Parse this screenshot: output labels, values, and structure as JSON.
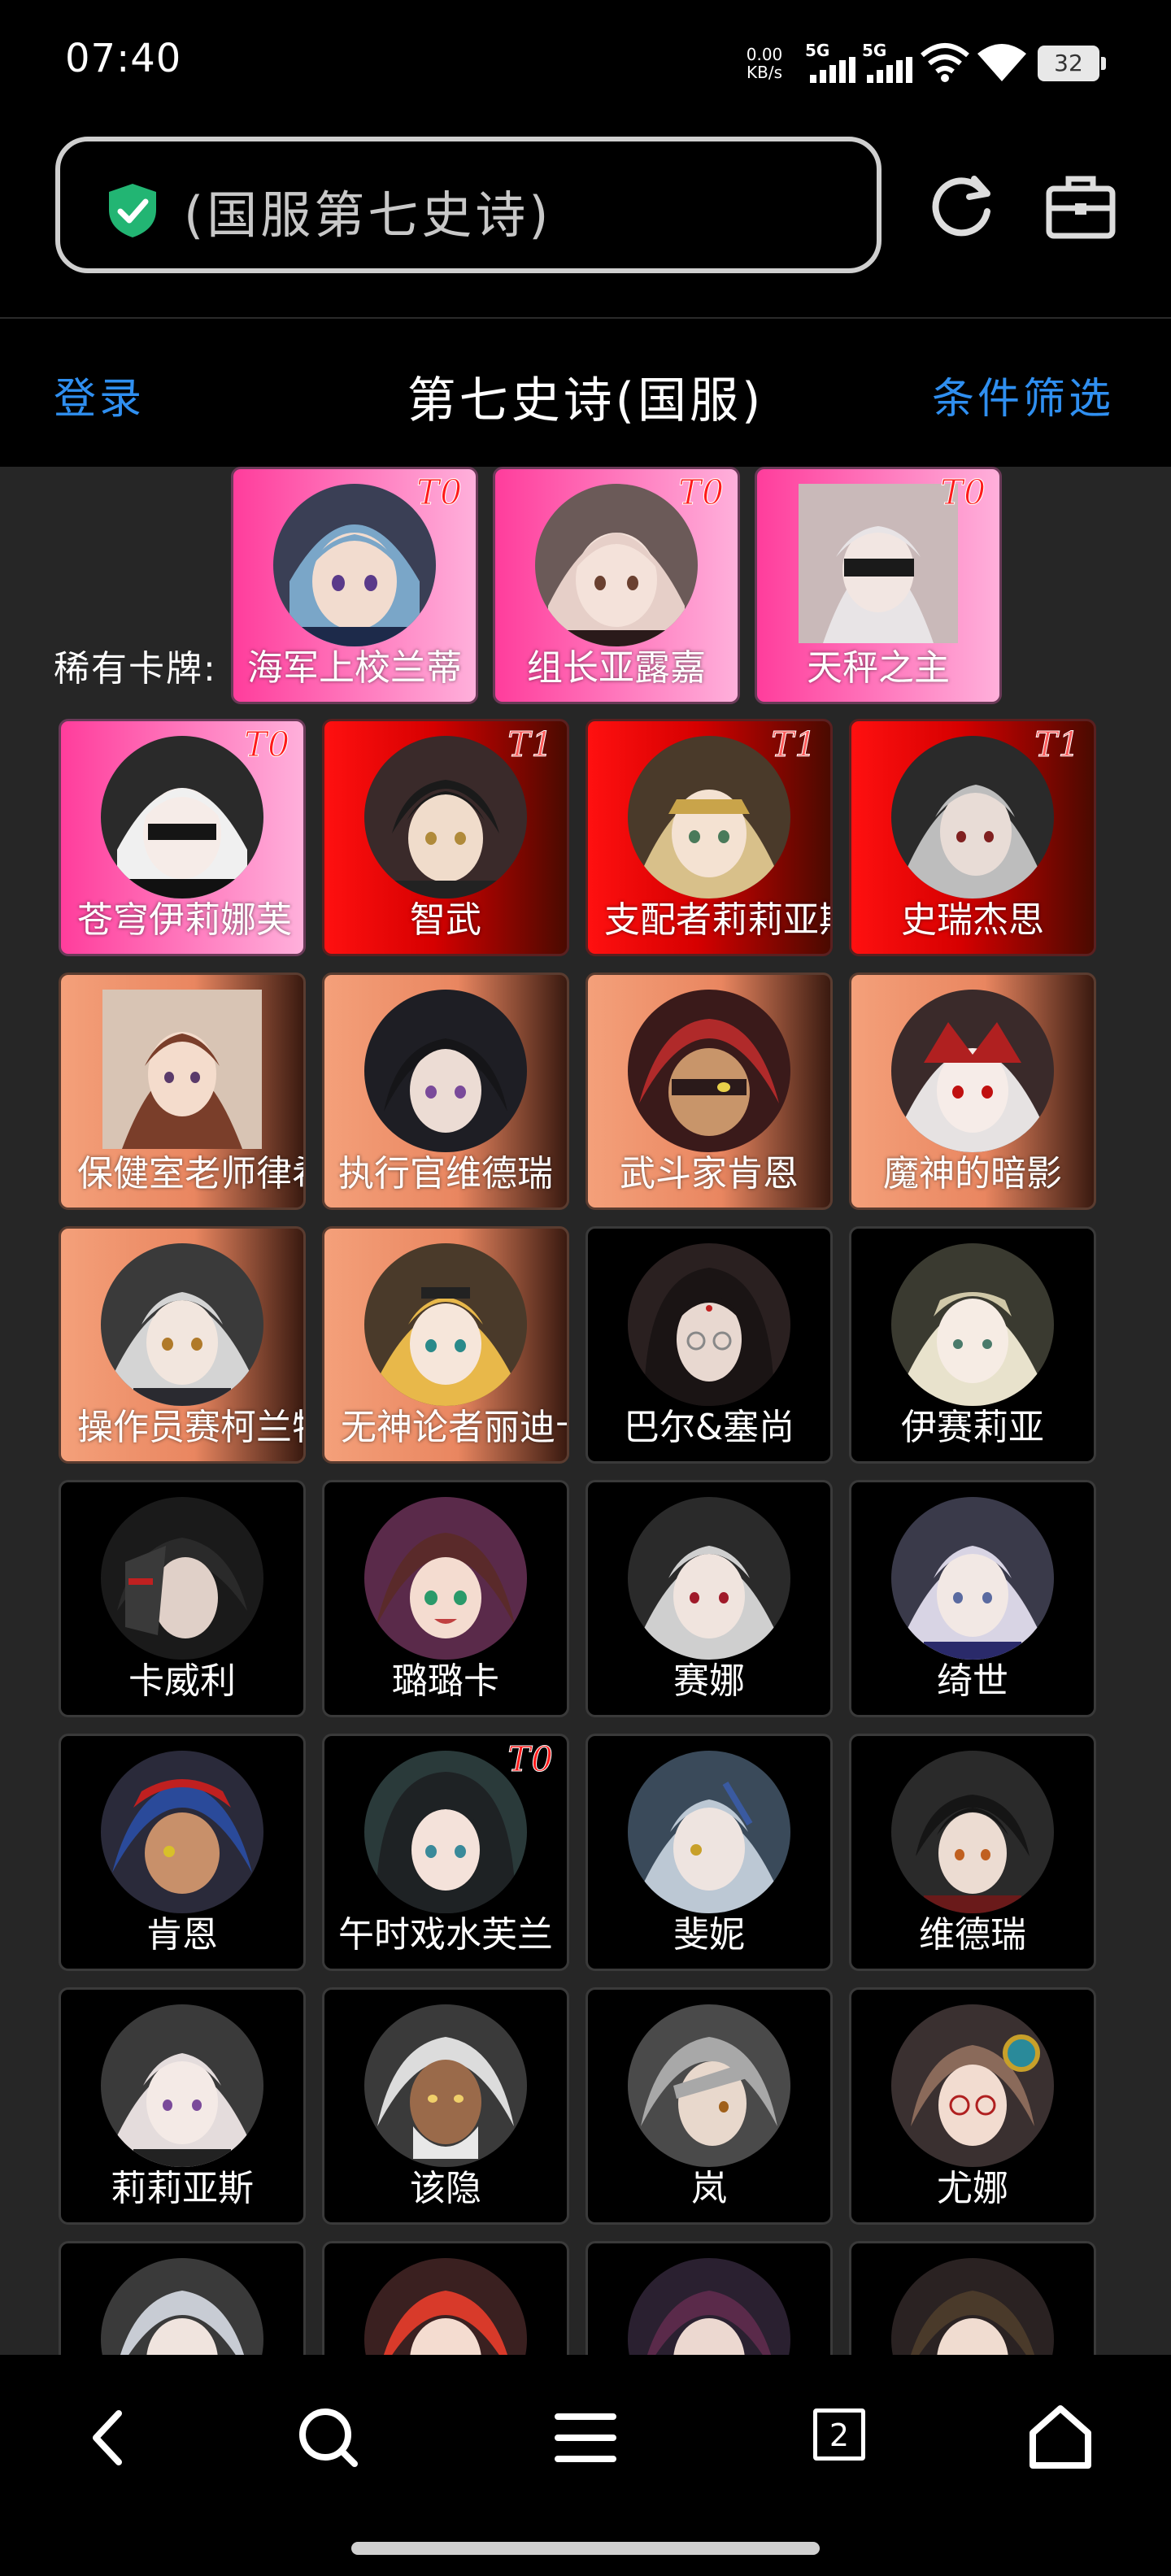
{
  "status_bar": {
    "time": "07:40",
    "net_speed_value": "0.00",
    "net_speed_unit": "KB/s",
    "signal1_label": "5G",
    "signal2_label": "5G",
    "battery": "32"
  },
  "address_bar": {
    "url_text": "(国服第七史诗)",
    "secure_color": "#22b573"
  },
  "header": {
    "login": "登录",
    "title": "第七史诗(国服)",
    "filter": "条件筛选"
  },
  "rare_section": {
    "label": "稀有卡牌:",
    "cards": [
      {
        "name": "海军上校兰蒂",
        "tier": "T0"
      },
      {
        "name": "组长亚露嘉",
        "tier": "T0"
      },
      {
        "name": "天秤之主",
        "tier": "T0"
      }
    ]
  },
  "grid": {
    "rows": [
      [
        {
          "name": "苍穹伊莉娜芙",
          "tier": "T0"
        },
        {
          "name": "智武",
          "tier": "T1"
        },
        {
          "name": "支配者莉莉亚斯",
          "tier": "T1"
        },
        {
          "name": "史瑞杰思",
          "tier": "T1"
        }
      ],
      [
        {
          "name": "保健室老师律希",
          "tier": ""
        },
        {
          "name": "执行官维德瑞",
          "tier": ""
        },
        {
          "name": "武斗家肯恩",
          "tier": ""
        },
        {
          "name": "魔神的暗影",
          "tier": ""
        }
      ],
      [
        {
          "name": "操作员赛柯兰特",
          "tier": ""
        },
        {
          "name": "无神论者丽迪卡",
          "tier": ""
        },
        {
          "name": "巴尔&塞尚",
          "tier": ""
        },
        {
          "name": "伊赛莉亚",
          "tier": ""
        }
      ],
      [
        {
          "name": "卡威利",
          "tier": ""
        },
        {
          "name": "璐璐卡",
          "tier": ""
        },
        {
          "name": "赛娜",
          "tier": ""
        },
        {
          "name": "绮世",
          "tier": ""
        }
      ],
      [
        {
          "name": "肯恩",
          "tier": ""
        },
        {
          "name": "午时戏水芙兰",
          "tier": "T0"
        },
        {
          "name": "斐妮",
          "tier": ""
        },
        {
          "name": "维德瑞",
          "tier": ""
        }
      ],
      [
        {
          "name": "莉莉亚斯",
          "tier": ""
        },
        {
          "name": "该隐",
          "tier": ""
        },
        {
          "name": "岚",
          "tier": ""
        },
        {
          "name": "尤娜",
          "tier": ""
        }
      ]
    ]
  },
  "bottom_nav": {
    "tabs_count": "2",
    "icons": [
      "back-icon",
      "search-icon",
      "menu-icon",
      "tabs-icon",
      "home-icon"
    ]
  }
}
